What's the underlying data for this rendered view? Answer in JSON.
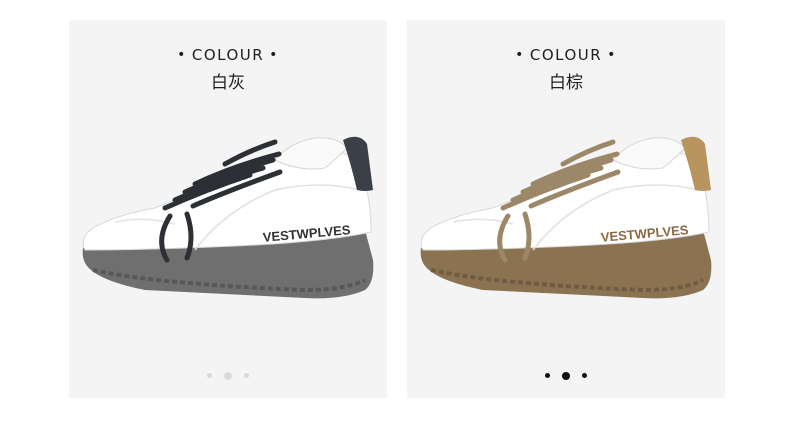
{
  "panels": [
    {
      "heading": "COLOUR",
      "color_name": "白灰",
      "brand_text": "VESTWPLVES",
      "accent_color": "#3b4048",
      "sole_color": "#6f6f6f",
      "lace_color": "#2c2f33",
      "pager": {
        "total": 3,
        "active": 2
      }
    },
    {
      "heading": "COLOUR",
      "color_name": "白棕",
      "brand_text": "VESTWPLVES",
      "accent_color": "#b8955f",
      "sole_color": "#8b7352",
      "lace_color": "#9c8868",
      "pager": {
        "total": 3,
        "active": 2
      }
    }
  ]
}
